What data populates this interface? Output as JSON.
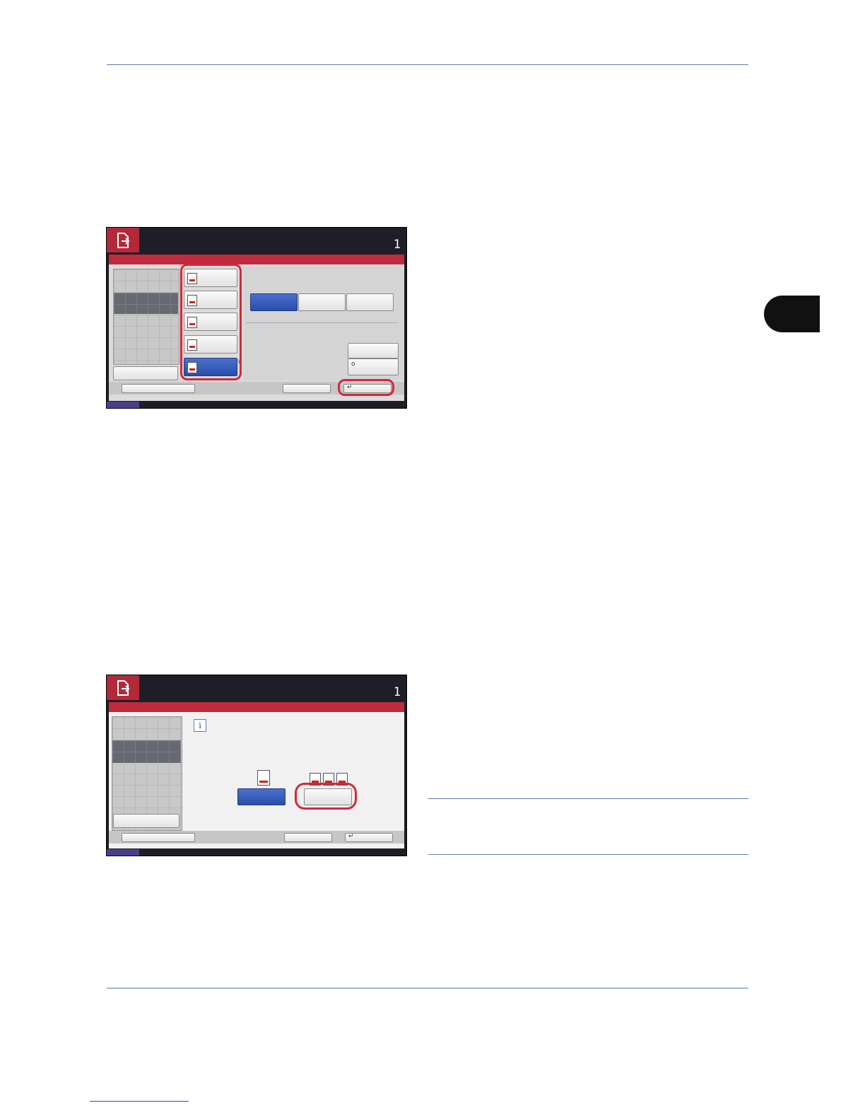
{
  "screen1": {
    "counter": "1",
    "icons": [
      "send-icon"
    ],
    "enter_symbol": "↵",
    "misc_symbol_v": "\\",
    "misc_symbol_o": "o"
  },
  "screen2": {
    "counter": "1",
    "icons": [
      "send-icon",
      "info-icon"
    ],
    "info_symbol": "i",
    "enter_symbol": "↵"
  }
}
